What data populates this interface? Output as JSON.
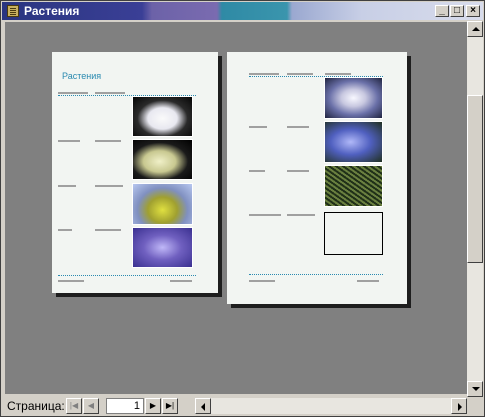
{
  "window": {
    "title": "Растения",
    "minimize_glyph": "_",
    "maximize_glyph": "□",
    "close_glyph": "×"
  },
  "report": {
    "title": "Растения"
  },
  "nav": {
    "label": "Страница:",
    "current_page": "1",
    "first_icon": "first-page-icon",
    "prev_icon": "prev-page-icon",
    "next_icon": "next-page-icon",
    "last_icon": "last-page-icon"
  },
  "colors": {
    "preview_bg": "#808080",
    "page_bg": "#f2f5f2",
    "accent": "#2a8ab0"
  }
}
